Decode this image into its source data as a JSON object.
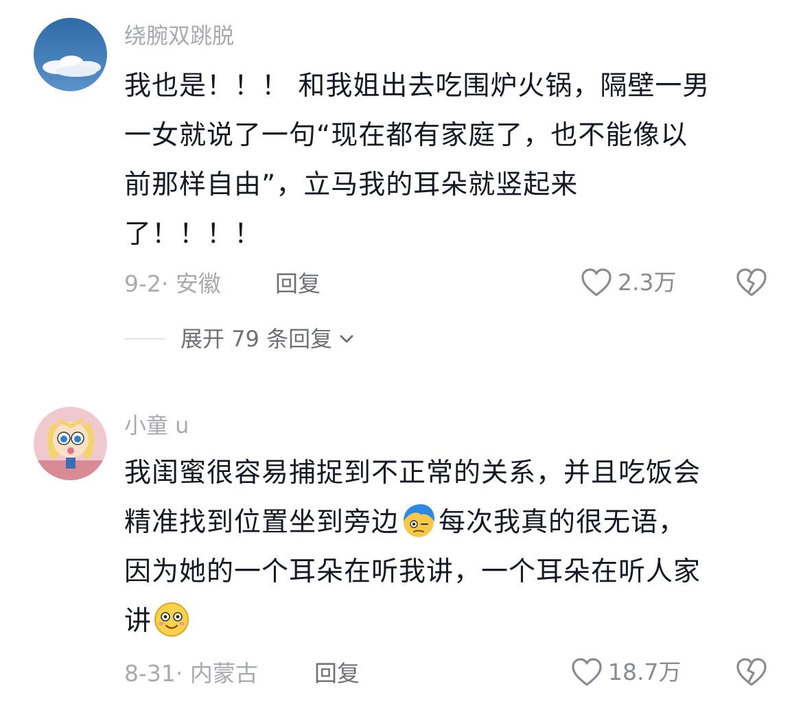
{
  "comments": [
    {
      "username": "绕腕双跳脱",
      "lines": [
        "我也是！！！ 和我姐出去吃围炉火锅，隔壁一男",
        "一女就说了一句“现在都有家庭了，也不能像以",
        "前那样自由”，立马我的耳朵就竖起来",
        "了！！！！"
      ],
      "date_location": "9-2· 安徽",
      "reply_label": "回复",
      "like_count": "2.3万",
      "expand_label": "展开 79 条回复"
    },
    {
      "username": "小童 u",
      "lines": [
        "我闺蜜很容易捕捉到不正常的关系，并且吃饭会",
        "精准找到位置坐到旁边",
        "每次我真的很无语，",
        "因为她的一个耳朵在听我讲，一个耳朵在听人家",
        "讲"
      ],
      "date_location": "8-31· 内蒙古",
      "reply_label": "回复",
      "like_count": "18.7万"
    }
  ],
  "icons": {
    "like": "heart-outline-icon",
    "dislike": "broken-heart-icon",
    "expand": "chevron-down-icon"
  },
  "colors": {
    "text": "#161823",
    "secondary": "#a8aaae",
    "action": "#6f7075"
  }
}
